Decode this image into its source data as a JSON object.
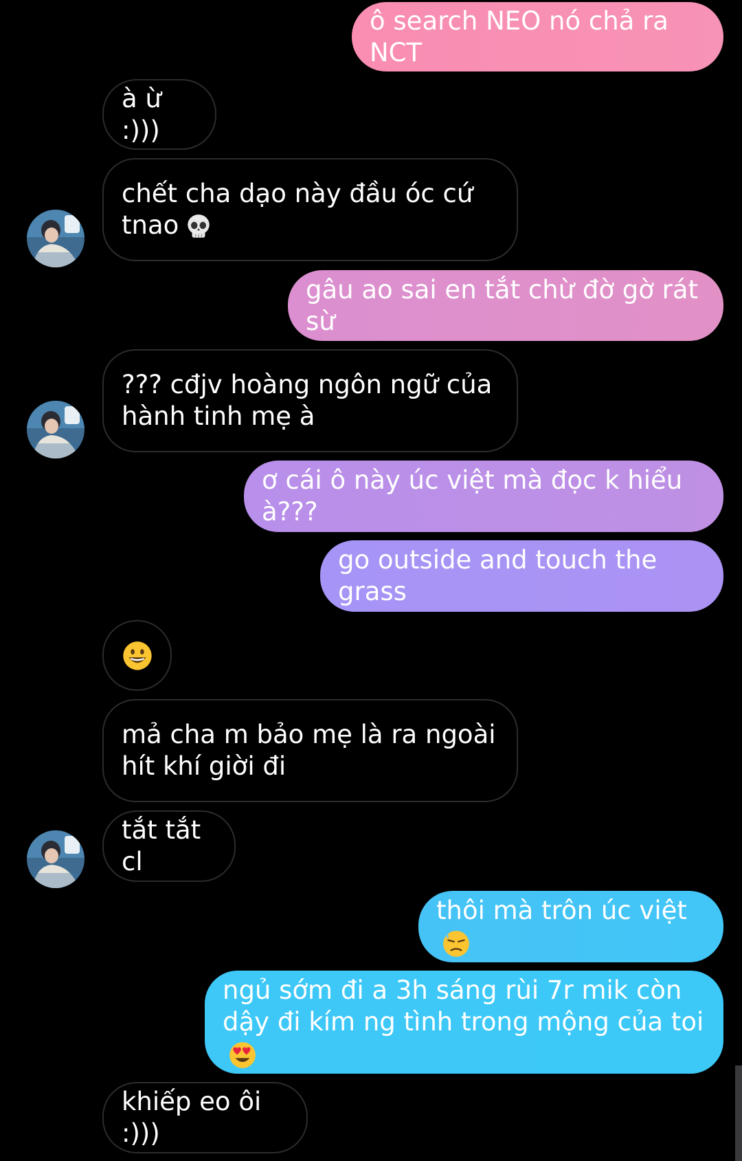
{
  "conversation": {
    "messages": [
      {
        "id": "m1",
        "direction": "sent",
        "text": "ô search NEO nó chả ra NCT"
      },
      {
        "id": "m2",
        "direction": "received",
        "text": "à ừ :)))"
      },
      {
        "id": "m3",
        "direction": "received",
        "text": "chết cha dạo này đầu óc cứ tnao",
        "emoji": "skull"
      },
      {
        "id": "m4",
        "direction": "sent",
        "text": "gâu ao sai en tắt chừ đờ gờ rát sừ"
      },
      {
        "id": "m5",
        "direction": "received",
        "text": "??? cđjv hoàng ngôn ngữ của hành tinh mẹ à"
      },
      {
        "id": "m6",
        "direction": "sent",
        "text": "ơ cái ô này úc việt mà đọc k hiểu à???"
      },
      {
        "id": "m7",
        "direction": "sent",
        "text": "go outside and touch the grass"
      },
      {
        "id": "m8",
        "direction": "received",
        "text": "",
        "emoji": "grinning-face"
      },
      {
        "id": "m9",
        "direction": "received",
        "text": "mả cha m bảo mẹ là ra ngoài hít khí giời đi"
      },
      {
        "id": "m10",
        "direction": "received",
        "text": "tắt tắt cl"
      },
      {
        "id": "m11",
        "direction": "sent",
        "text": "thôi mà trôn úc việt",
        "emoji": "downcast-face-with-sweat"
      },
      {
        "id": "m12",
        "direction": "sent",
        "text": "ngủ sớm đi a 3h sáng rùi 7r mik còn dậy đi kím ng tình trong mộng của toi",
        "emoji": "heart-eyes"
      },
      {
        "id": "m13",
        "direction": "received",
        "text": "khiếp eo ôi :)))"
      }
    ]
  },
  "colors": {
    "background": "#000000",
    "received_border": "#2c2c2e",
    "gradient_top": "#f78fb3",
    "gradient_mid": "#c58fe8",
    "gradient_lavender": "#a892f5",
    "gradient_bottom": "#3ec8f7",
    "text": "#ffffff"
  },
  "icons": [
    "skull-icon",
    "grinning-face-icon",
    "downcast-sweat-icon",
    "heart-eyes-icon",
    "avatar-image"
  ]
}
